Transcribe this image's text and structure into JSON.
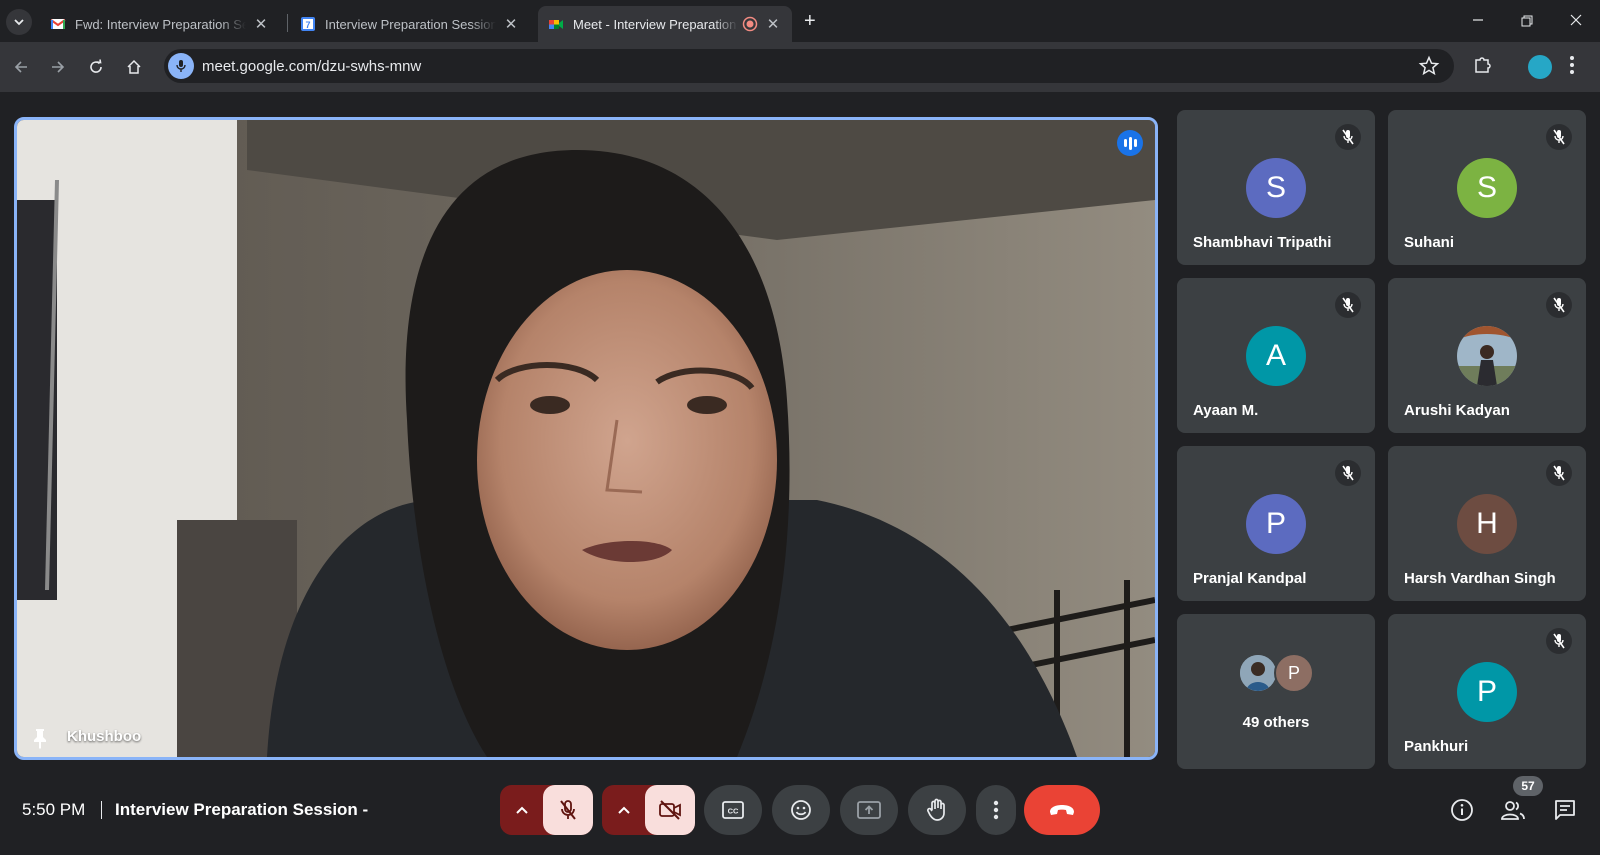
{
  "browser": {
    "tabs": [
      {
        "title": "Fwd: Interview Preparation Session",
        "icon": "gmail-icon"
      },
      {
        "title": "Interview Preparation Session - ",
        "icon": "calendar-icon"
      },
      {
        "title": "Meet - Interview Preparation Session",
        "icon": "meet-icon",
        "active": true,
        "recording": true
      }
    ],
    "url": "meet.google.com/dzu-swhs-mnw"
  },
  "stage": {
    "speaker_name": "Khushboo",
    "speaking": true,
    "pinned": true
  },
  "participants": [
    {
      "name": "Shambhavi Tripathi",
      "initial": "S",
      "color": "#5c6bc0",
      "muted": true
    },
    {
      "name": "Suhani",
      "initial": "S",
      "color": "#7cb342",
      "muted": true
    },
    {
      "name": "Ayaan M.",
      "initial": "A",
      "color": "#0097a7",
      "muted": true
    },
    {
      "name": "Arushi Kadyan",
      "initial": "",
      "color": "#8d6e63",
      "muted": true,
      "photo": true
    },
    {
      "name": "Pranjal Kandpal",
      "initial": "P",
      "color": "#5c6bc0",
      "muted": true
    },
    {
      "name": "Harsh Vardhan Singh",
      "initial": "H",
      "color": "#6d4c41",
      "muted": true
    },
    {
      "name": "Pankhuri",
      "initial": "P",
      "color": "#0097a7",
      "muted": true
    }
  ],
  "others": {
    "label": "49 others",
    "avatar_initial": "P",
    "avatar_color": "#8d6e63"
  },
  "footer": {
    "time": "5:50 PM",
    "meeting_title": "Interview Preparation Session -",
    "participant_count": "57"
  },
  "colors": {
    "accent": "#8ab4f8",
    "end_call": "#ea4335",
    "muted_bg": "#f9dedc"
  }
}
